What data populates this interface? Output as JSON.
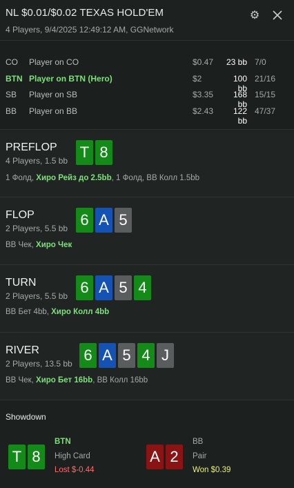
{
  "header": {
    "title": "NL $0.01/$0.02 TEXAS HOLD'EM",
    "subtitle": "4 Players, 9/4/2025 12:49:12 AM, GGNetwork"
  },
  "players": [
    {
      "pos": "CO",
      "name": "Player on CO",
      "stack": "$0.47",
      "bb": "23 bb",
      "stats": "7/0",
      "hero": false
    },
    {
      "pos": "BTN",
      "name": "Player on BTN (Hero)",
      "stack": "$2",
      "bb": "100 bb",
      "stats": "21/16",
      "hero": true
    },
    {
      "pos": "SB",
      "name": "Player on SB",
      "stack": "$3.35",
      "bb": "168 bb",
      "stats": "15/15",
      "hero": false
    },
    {
      "pos": "BB",
      "name": "Player on BB",
      "stack": "$2.43",
      "bb": "122 bb",
      "stats": "47/37",
      "hero": false
    }
  ],
  "streets": {
    "preflop": {
      "name": "PREFLOP",
      "info": "4 Players, 1.5 bb",
      "cards": [
        {
          "rank": "T",
          "color": "green"
        },
        {
          "rank": "8",
          "color": "green"
        }
      ],
      "action_pre": "1 Фолд, ",
      "action_hero": "Хиро Рейз до 2.5bb",
      "action_post": ", 1 Фолд, BB Колл 1.5bb"
    },
    "flop": {
      "name": "FLOP",
      "info": "2 Players, 5.5 bb",
      "cards": [
        {
          "rank": "6",
          "color": "green"
        },
        {
          "rank": "A",
          "color": "blue"
        },
        {
          "rank": "5",
          "color": "gray"
        }
      ],
      "action_pre": "BB Чек, ",
      "action_hero": "Хиро Чек",
      "action_post": ""
    },
    "turn": {
      "name": "TURN",
      "info": "2 Players, 5.5 bb",
      "cards": [
        {
          "rank": "6",
          "color": "green"
        },
        {
          "rank": "A",
          "color": "blue"
        },
        {
          "rank": "5",
          "color": "gray"
        },
        {
          "rank": "4",
          "color": "green"
        }
      ],
      "action_pre": "BB Бет 4bb, ",
      "action_hero": "Хиро Колл 4bb",
      "action_post": ""
    },
    "river": {
      "name": "RIVER",
      "info": "2 Players, 13.5 bb",
      "cards": [
        {
          "rank": "6",
          "color": "green"
        },
        {
          "rank": "A",
          "color": "blue"
        },
        {
          "rank": "5",
          "color": "gray"
        },
        {
          "rank": "4",
          "color": "green"
        },
        {
          "rank": "J",
          "color": "gray"
        }
      ],
      "action_pre": "BB Чек, ",
      "action_hero": "Хиро Бет 16bb",
      "action_post": ", BB Колл 16bb"
    }
  },
  "showdown": {
    "title": "Showdown",
    "hero": {
      "pos": "BTN",
      "hand": "High Card",
      "result": "Lost $-0.44",
      "cards": [
        {
          "rank": "T",
          "color": "green"
        },
        {
          "rank": "8",
          "color": "green"
        }
      ]
    },
    "villain": {
      "pos": "BB",
      "hand": "Pair",
      "result": "Won $0.39",
      "cards": [
        {
          "rank": "A",
          "color": "red"
        },
        {
          "rank": "2",
          "color": "red"
        }
      ]
    }
  },
  "colors": {
    "hero_green": "#7ee07a",
    "lost_red": "#ff6b6b",
    "won_yellow": "#e8f07a",
    "card_green": "#148a19",
    "card_blue": "#1452b4",
    "card_gray": "#5a5d5d",
    "card_red": "#8a1414"
  },
  "icons": {
    "settings": "gear-icon",
    "close": "close-icon"
  }
}
